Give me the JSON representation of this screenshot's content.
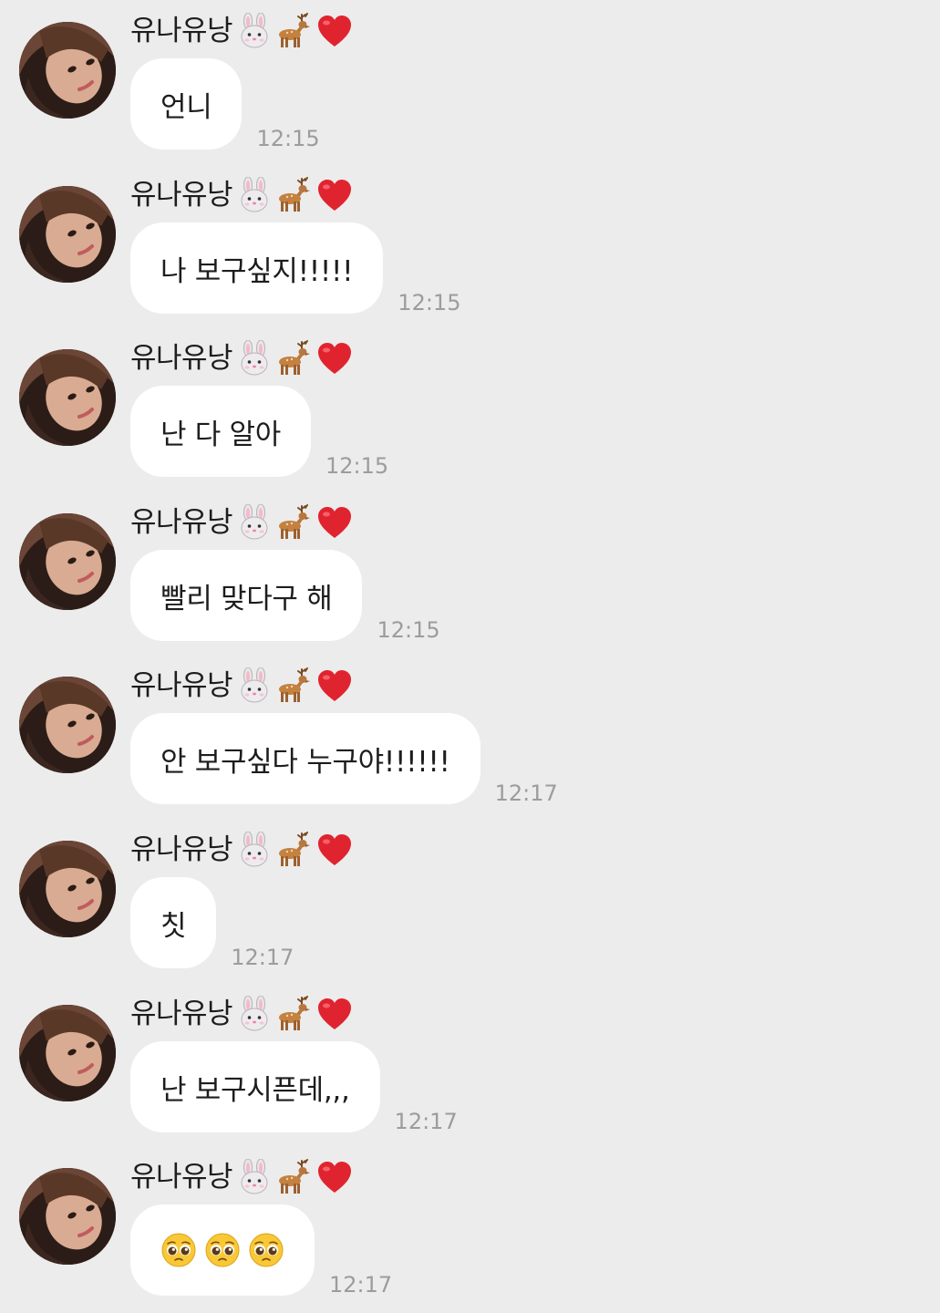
{
  "chat": {
    "sender": "유나유낭",
    "sender_emoji": [
      "rabbit-face-icon",
      "deer-icon",
      "red-heart-icon"
    ],
    "messages": [
      {
        "text": "언니",
        "time": "12:15"
      },
      {
        "text": "나 보구싶지!!!!!",
        "time": "12:15"
      },
      {
        "text": "난 다 알아",
        "time": "12:15"
      },
      {
        "text": "빨리 맞다구 해",
        "time": "12:15"
      },
      {
        "text": "안 보구싶다 누구야!!!!!!",
        "time": "12:17"
      },
      {
        "text": "칫",
        "time": "12:17"
      },
      {
        "text": "난 보구시픈데,,,",
        "time": "12:17"
      },
      {
        "text": "",
        "emoji": [
          "pleading-face-icon",
          "pleading-face-icon",
          "pleading-face-icon"
        ],
        "time": "12:17"
      }
    ]
  },
  "colors": {
    "background": "#ececec",
    "bubble": "#ffffff",
    "text": "#1d1d1d",
    "time": "#9c9c9c",
    "heart": "#e0242f"
  }
}
